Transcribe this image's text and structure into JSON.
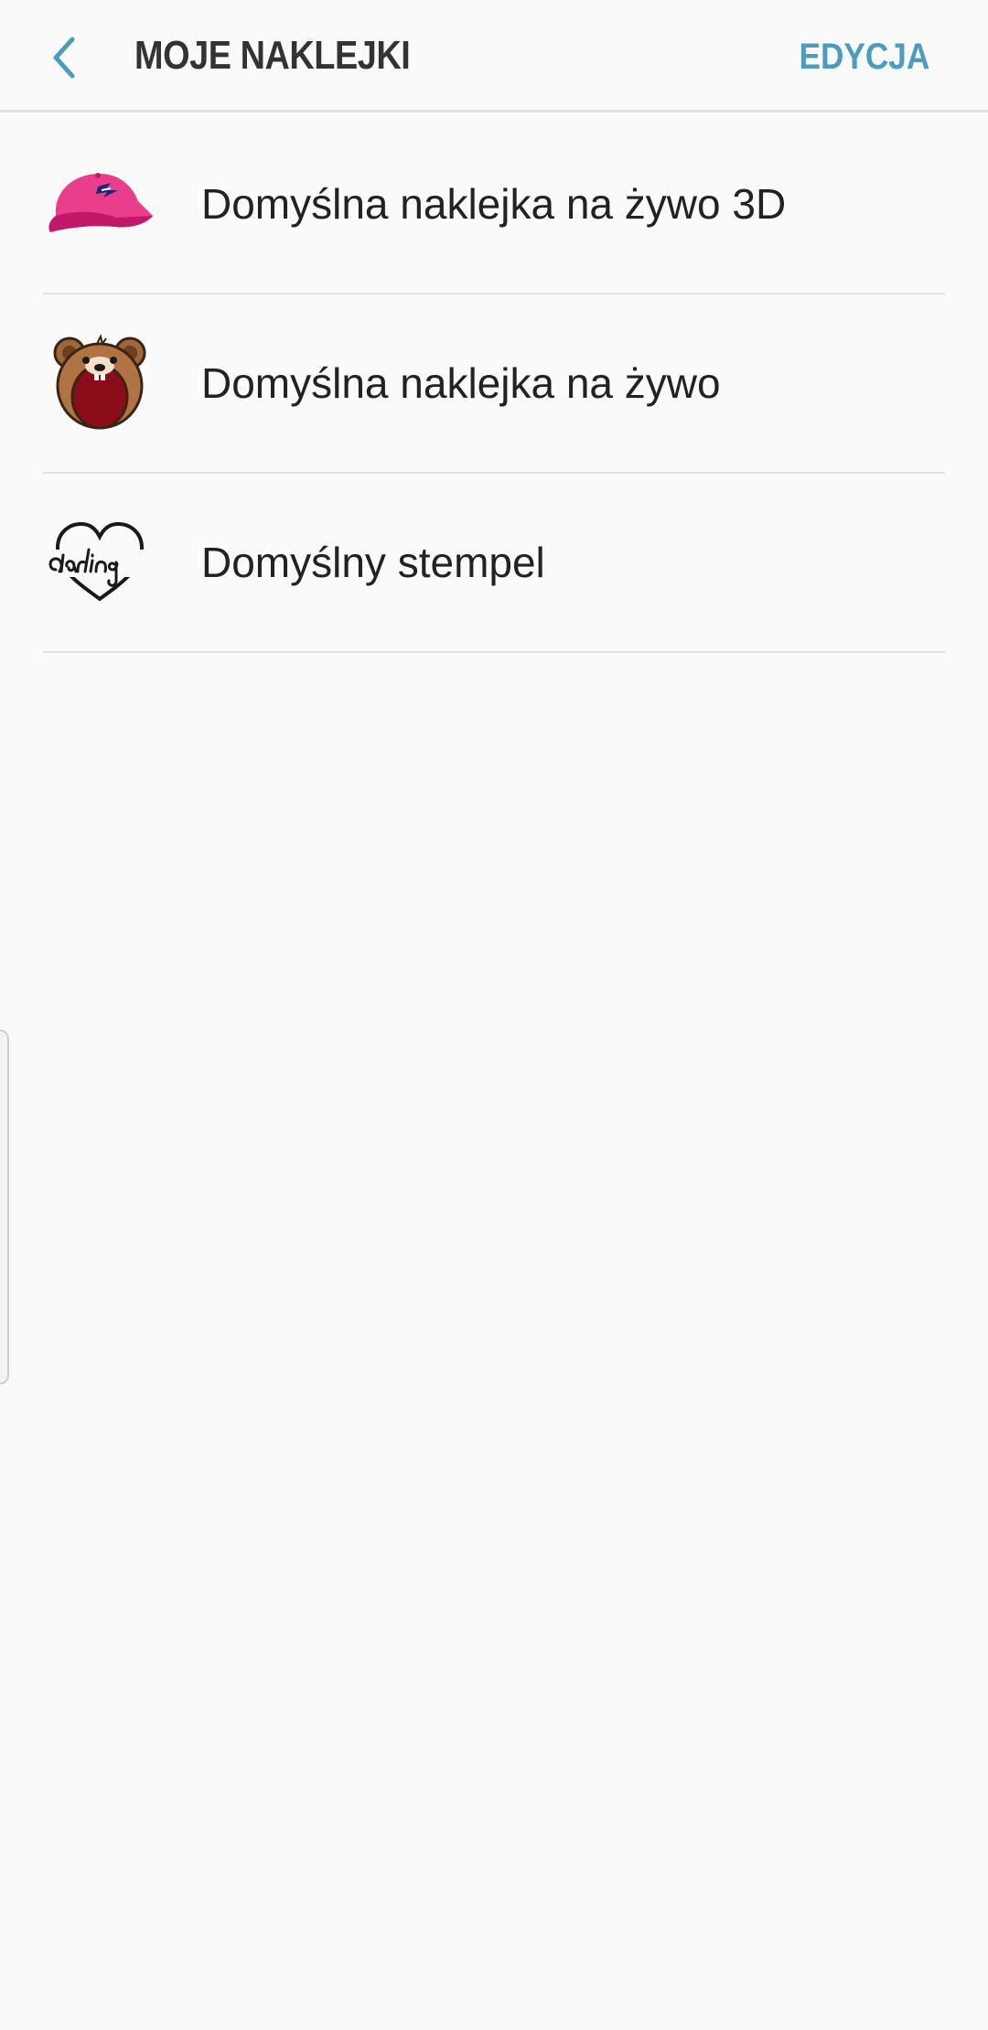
{
  "header": {
    "back_icon": "chevron-left-icon",
    "title": "MOJE NAKLEJKI",
    "edit_label": "EDYCJA",
    "accent_color": "#4a9dbf"
  },
  "stickers": {
    "items": [
      {
        "label": "Domyślna naklejka na żywo 3D",
        "icon": "pink-cap-icon"
      },
      {
        "label": "Domyślna naklejka na żywo",
        "icon": "bear-face-icon"
      },
      {
        "label": "Domyślny stempel",
        "icon": "darling-heart-icon"
      }
    ]
  }
}
